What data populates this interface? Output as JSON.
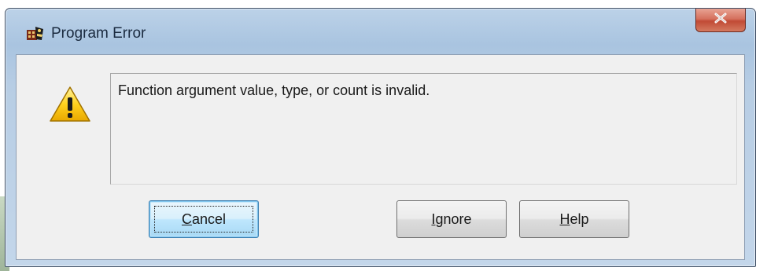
{
  "window": {
    "title": "Program Error",
    "close_glyph": "x"
  },
  "message": {
    "text": "Function argument value, type, or count is invalid."
  },
  "buttons": {
    "cancel": {
      "accel": "C",
      "rest": "ancel"
    },
    "ignore": {
      "accel": "I",
      "rest": "gnore"
    },
    "help": {
      "accel": "H",
      "rest": "elp"
    }
  },
  "icons": {
    "title": "app-icon",
    "warning": "warning-icon"
  },
  "colors": {
    "frame": "#b7cde4",
    "close_button": "#c9503b",
    "default_button": "#bee6fd",
    "warning": "#f5c400"
  }
}
